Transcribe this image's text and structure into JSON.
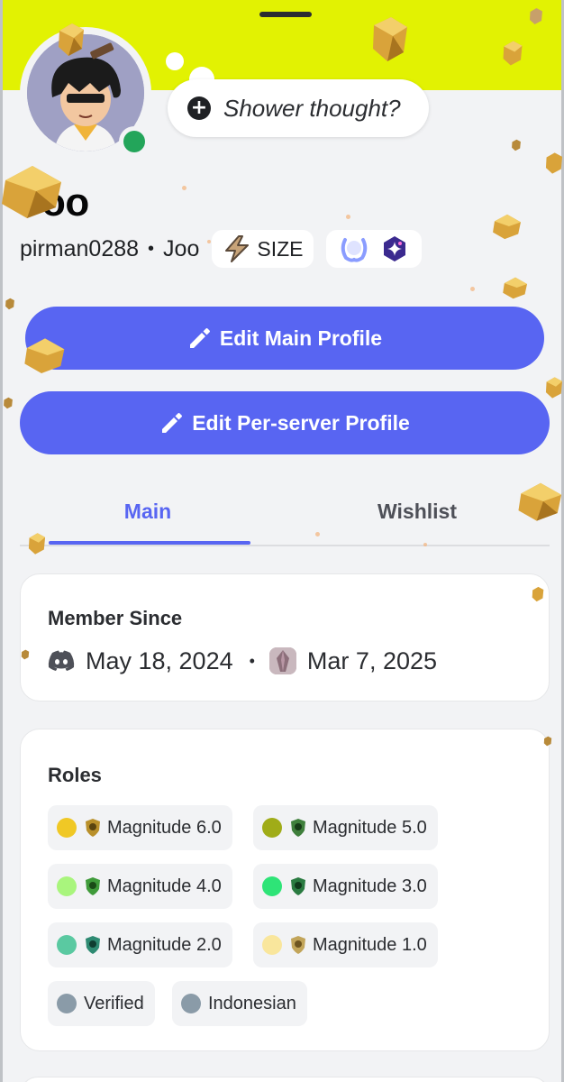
{
  "colors": {
    "banner": "#e2f202",
    "accent": "#5865f2",
    "online": "#23a55a",
    "page_bg": "#f2f3f5"
  },
  "profile": {
    "display_name": "Joo",
    "username": "pirman0288",
    "separator": "•",
    "pronouns": "Joo",
    "guild_tag": {
      "icon": "lightning-tag-icon",
      "label": "SIZE"
    },
    "badges": [
      "laurel-badge-icon",
      "quest-star-badge-icon"
    ],
    "status": "online"
  },
  "status_bubble": {
    "icon": "plus-circle-icon",
    "placeholder": "Shower thought?"
  },
  "buttons": {
    "edit_main": "Edit Main Profile",
    "edit_server": "Edit Per-server Profile"
  },
  "tabs": [
    {
      "label": "Main",
      "active": true
    },
    {
      "label": "Wishlist",
      "active": false
    }
  ],
  "member_since": {
    "title": "Member Since",
    "discord_date": "May 18, 2024",
    "separator": "•",
    "server_date": "Mar 7, 2025"
  },
  "roles": {
    "title": "Roles",
    "items": [
      {
        "label": "Magnitude 6.0",
        "color": "#f0c825",
        "badge": "shield-badge-icon",
        "badge_color": "#b9902a"
      },
      {
        "label": "Magnitude 5.0",
        "color": "#a0ac18",
        "badge": "shield-badge-icon",
        "badge_color": "#3f7f3c"
      },
      {
        "label": "Magnitude 4.0",
        "color": "#a9f57d",
        "badge": "shield-badge-icon",
        "badge_color": "#3f9b3a"
      },
      {
        "label": "Magnitude 3.0",
        "color": "#2ee477",
        "badge": "shield-badge-icon",
        "badge_color": "#2a7b41"
      },
      {
        "label": "Magnitude 2.0",
        "color": "#5ac9a1",
        "badge": "shield-badge-icon",
        "badge_color": "#2e8a72"
      },
      {
        "label": "Magnitude 1.0",
        "color": "#f9e69c",
        "badge": "shield-badge-icon",
        "badge_color": "#c2a55a"
      },
      {
        "label": "Verified",
        "color": "#8a9ba8"
      },
      {
        "label": "Indonesian",
        "color": "#8a9ba8"
      }
    ]
  }
}
